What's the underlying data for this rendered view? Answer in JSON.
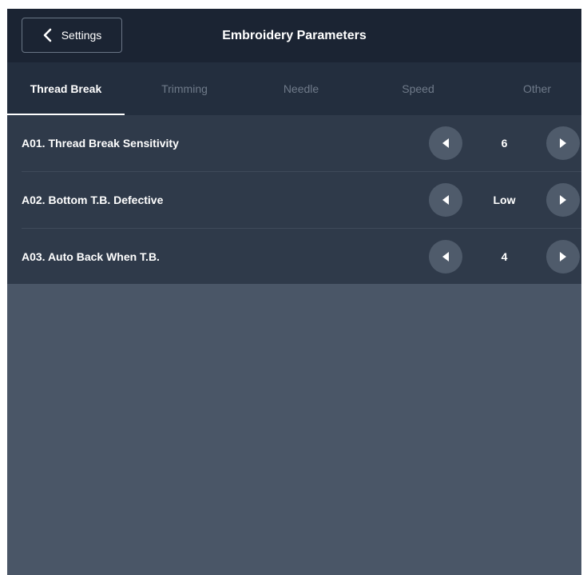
{
  "header": {
    "back_label": "Settings",
    "title": "Embroidery Parameters"
  },
  "tabs": [
    {
      "label": "Thread Break",
      "active": true
    },
    {
      "label": "Trimming",
      "active": false
    },
    {
      "label": "Needle",
      "active": false
    },
    {
      "label": "Speed",
      "active": false
    },
    {
      "label": "Other",
      "active": false
    }
  ],
  "parameters": [
    {
      "label": "A01. Thread Break Sensitivity",
      "value": "6"
    },
    {
      "label": "A02. Bottom T.B. Defective",
      "value": "Low"
    },
    {
      "label": "A03. Auto Back When T.B.",
      "value": "4"
    }
  ],
  "icons": {
    "back": "chevron-left-icon",
    "decrement": "triangle-left-icon",
    "increment": "triangle-right-icon"
  },
  "colors": {
    "header_bg": "#1b2433",
    "tabs_bg": "#232e3e",
    "list_bg": "#2f3a4a",
    "body_bg": "#4a5667",
    "button_bg": "#4f5b6b",
    "inactive_tab": "#6f7a89"
  }
}
